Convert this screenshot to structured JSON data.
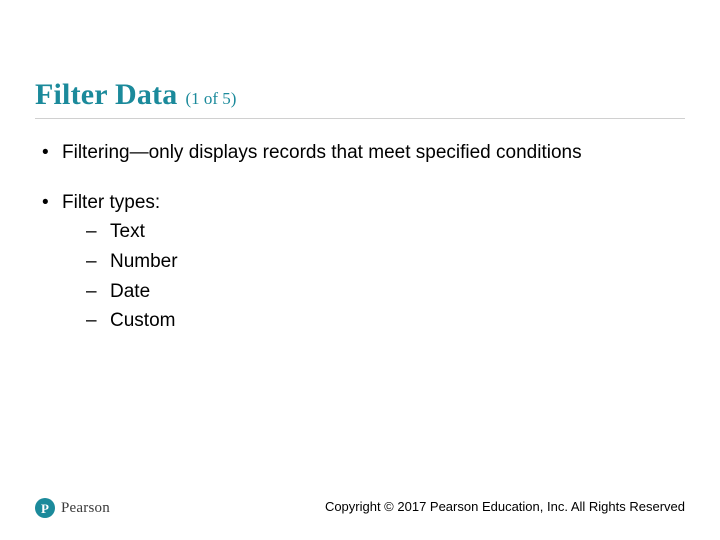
{
  "title": {
    "main": "Filter Data",
    "pager": "(1 of 5)"
  },
  "bullets": {
    "item0": "Filtering—only displays records that meet specified conditions",
    "item1": {
      "lead": "Filter types:",
      "sub0": "Text",
      "sub1": "Number",
      "sub2": "Date",
      "sub3": "Custom"
    }
  },
  "brand": {
    "logo_letter": "P",
    "name": "Pearson"
  },
  "copyright": "Copyright © 2017 Pearson Education, Inc. All Rights Reserved"
}
